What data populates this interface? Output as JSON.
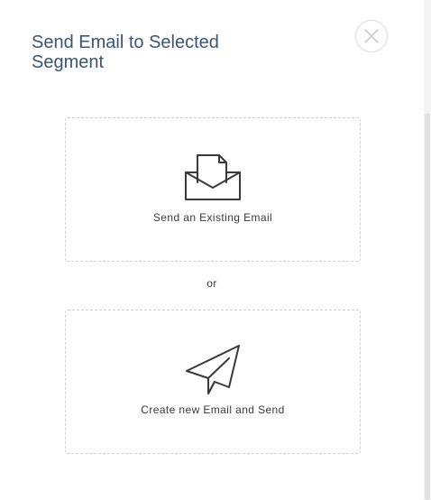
{
  "dialog": {
    "title": "Send Email to Selected Segment",
    "close_icon": "close-icon"
  },
  "options": {
    "existing": {
      "label": "Send an Existing Email",
      "icon": "envelope-icon"
    },
    "separator": "or",
    "new": {
      "label": "Create new Email and Send",
      "icon": "paper-plane-icon"
    }
  },
  "colors": {
    "title": "#3b5478",
    "icon_stroke": "#3a3a3a",
    "card_border": "#cfcfcf",
    "close_border": "#dadde3"
  }
}
